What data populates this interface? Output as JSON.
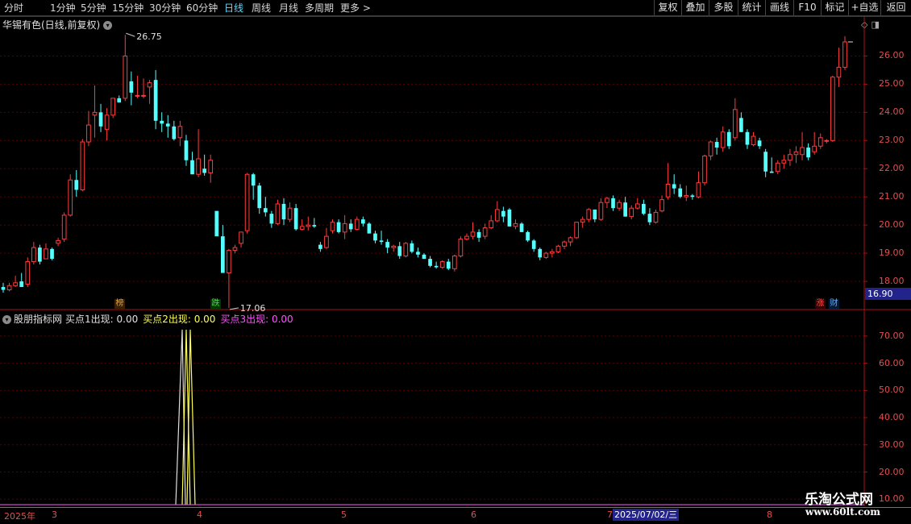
{
  "toolbar": {
    "periods": [
      "分时",
      "1分钟",
      "5分钟",
      "15分钟",
      "30分钟",
      "60分钟",
      "日线",
      "周线",
      "月线",
      "多周期",
      "更多 >"
    ],
    "active_period": "日线",
    "right_buttons": [
      "复权",
      "叠加",
      "多股",
      "统计",
      "画线",
      "F10",
      "标记",
      "+自选",
      "返回"
    ]
  },
  "main_chart": {
    "title": "华锡有色(日线,前复权)",
    "y_ticks": [
      "26.00",
      "25.00",
      "24.00",
      "23.00",
      "22.00",
      "21.00",
      "20.00",
      "19.00",
      "18.00"
    ],
    "high_label": "26.75",
    "low_label": "17.06",
    "current_price": "16.90",
    "markers": [
      {
        "text": "榜",
        "color": "#e0a030",
        "bg": "#3a2000"
      },
      {
        "text": "跌",
        "color": "#40e040",
        "bg": "#003a00"
      },
      {
        "text": "涨",
        "color": "#ff5050",
        "bg": "#3a0000"
      },
      {
        "text": "财",
        "color": "#5fa8ff",
        "bg": "#001a3a"
      }
    ]
  },
  "indicator": {
    "name": "股朋指标网",
    "buy1": "买点1出现: 0.00",
    "buy2": "买点2出现: 0.00",
    "buy3": "买点3出现: 0.00",
    "y_ticks": [
      "70.00",
      "60.00",
      "50.00",
      "40.00",
      "30.00",
      "20.00",
      "10.00"
    ]
  },
  "time_axis": {
    "labels": [
      "2025年",
      "3",
      "4",
      "5",
      "6",
      "7",
      "8"
    ],
    "current_date": "2025/07/02/三"
  },
  "watermark": {
    "name": "乐淘公式网",
    "url": "www.60lt.com"
  },
  "colors": {
    "up": "#ff3c3c",
    "down": "#54ffff",
    "axis": "#b01010",
    "grid": "#5a0000",
    "buy2_line": "#ffff54",
    "buy1_line": "#e0e0e0",
    "buy3_line": "#ff54ff"
  },
  "chart_data": {
    "type": "candlestick",
    "ylim": [
      17.4,
      26.9
    ],
    "ohlc": [
      [
        17.8,
        17.95,
        17.6,
        17.7
      ],
      [
        17.7,
        17.95,
        17.65,
        17.85
      ],
      [
        17.85,
        18.2,
        17.8,
        17.95
      ],
      [
        18.0,
        18.3,
        17.9,
        17.8
      ],
      [
        17.9,
        18.85,
        17.8,
        18.7
      ],
      [
        18.7,
        19.4,
        18.6,
        19.2
      ],
      [
        19.2,
        19.3,
        18.6,
        18.7
      ],
      [
        18.8,
        19.35,
        18.8,
        19.15
      ],
      [
        19.15,
        19.2,
        18.75,
        18.8
      ],
      [
        19.35,
        19.55,
        19.25,
        19.45
      ],
      [
        19.5,
        20.45,
        19.4,
        20.35
      ],
      [
        20.35,
        21.8,
        20.3,
        21.6
      ],
      [
        21.6,
        21.95,
        21.0,
        21.25
      ],
      [
        21.25,
        23.05,
        21.2,
        22.95
      ],
      [
        22.95,
        24.05,
        22.8,
        23.55
      ],
      [
        23.9,
        24.95,
        23.1,
        24.0
      ],
      [
        24.0,
        24.3,
        23.3,
        23.5
      ],
      [
        23.4,
        24.15,
        23.0,
        23.9
      ],
      [
        23.9,
        24.5,
        23.8,
        24.5
      ],
      [
        24.5,
        24.6,
        24.35,
        24.35
      ],
      [
        24.5,
        26.75,
        24.4,
        26.0
      ],
      [
        25.1,
        25.45,
        24.25,
        24.7
      ],
      [
        24.6,
        25.3,
        24.5,
        24.6
      ],
      [
        24.6,
        25.2,
        24.5,
        24.6
      ],
      [
        24.9,
        25.15,
        24.3,
        25.05
      ],
      [
        25.15,
        25.5,
        23.4,
        23.7
      ],
      [
        23.7,
        24.0,
        23.3,
        23.6
      ],
      [
        23.6,
        23.9,
        23.1,
        23.5
      ],
      [
        23.5,
        23.7,
        23.0,
        23.05
      ],
      [
        23.1,
        23.7,
        22.8,
        23.5
      ],
      [
        23.0,
        23.2,
        22.1,
        22.3
      ],
      [
        22.3,
        22.6,
        21.8,
        21.8
      ],
      [
        21.8,
        23.4,
        21.7,
        22.35
      ],
      [
        22.0,
        22.5,
        21.75,
        21.85
      ],
      [
        21.85,
        22.5,
        21.5,
        22.3
      ],
      [
        20.5,
        20.0,
        19.7,
        19.6
      ],
      [
        19.6,
        20.0,
        18.6,
        18.3
      ],
      [
        18.3,
        19.15,
        17.06,
        19.1
      ],
      [
        19.1,
        19.3,
        19.0,
        19.2
      ],
      [
        19.35,
        19.75,
        19.2,
        19.75
      ],
      [
        19.8,
        21.85,
        19.7,
        21.8
      ],
      [
        21.8,
        21.85,
        20.9,
        21.4
      ],
      [
        21.4,
        21.5,
        20.4,
        20.6
      ],
      [
        20.6,
        21.0,
        20.3,
        20.45
      ],
      [
        20.4,
        20.5,
        19.9,
        20.05
      ],
      [
        20.05,
        20.9,
        20.0,
        20.75
      ],
      [
        20.75,
        20.95,
        20.0,
        20.2
      ],
      [
        20.2,
        20.8,
        20.1,
        20.6
      ],
      [
        20.6,
        20.75,
        19.8,
        19.85
      ],
      [
        19.85,
        20.2,
        19.8,
        19.95
      ],
      [
        19.95,
        20.3,
        19.8,
        20.0
      ],
      [
        20.0,
        20.25,
        19.9,
        19.95
      ],
      [
        19.3,
        19.4,
        19.05,
        19.15
      ],
      [
        19.2,
        19.9,
        19.15,
        19.6
      ],
      [
        19.8,
        20.2,
        19.7,
        20.1
      ],
      [
        20.1,
        20.2,
        19.7,
        19.75
      ],
      [
        19.75,
        20.35,
        19.5,
        20.05
      ],
      [
        20.05,
        20.2,
        19.75,
        19.85
      ],
      [
        19.85,
        20.3,
        19.8,
        20.2
      ],
      [
        20.2,
        20.3,
        19.95,
        20.05
      ],
      [
        20.05,
        20.1,
        19.7,
        19.7
      ],
      [
        19.7,
        19.8,
        19.35,
        19.45
      ],
      [
        19.45,
        19.8,
        19.3,
        19.4
      ],
      [
        19.4,
        19.5,
        19.0,
        19.2
      ],
      [
        19.2,
        19.3,
        19.05,
        19.25
      ],
      [
        19.25,
        19.4,
        18.8,
        18.9
      ],
      [
        18.9,
        19.4,
        18.85,
        19.35
      ],
      [
        19.35,
        19.45,
        19.0,
        19.05
      ],
      [
        19.05,
        19.2,
        18.85,
        18.95
      ],
      [
        18.95,
        19.0,
        18.8,
        18.8
      ],
      [
        18.8,
        18.9,
        18.5,
        18.55
      ],
      [
        18.55,
        18.7,
        18.45,
        18.5
      ],
      [
        18.5,
        18.75,
        18.45,
        18.7
      ],
      [
        18.7,
        18.8,
        18.4,
        18.45
      ],
      [
        18.45,
        18.95,
        18.35,
        18.9
      ],
      [
        18.9,
        19.6,
        18.85,
        19.5
      ],
      [
        19.5,
        19.7,
        19.45,
        19.6
      ],
      [
        19.6,
        20.1,
        19.5,
        19.75
      ],
      [
        19.75,
        19.85,
        19.4,
        19.55
      ],
      [
        19.6,
        20.05,
        19.5,
        19.9
      ],
      [
        19.9,
        20.35,
        19.85,
        20.15
      ],
      [
        20.15,
        20.85,
        20.1,
        20.55
      ],
      [
        20.5,
        20.65,
        20.1,
        20.3
      ],
      [
        20.55,
        20.6,
        19.95,
        19.95
      ],
      [
        19.95,
        20.2,
        19.85,
        20.05
      ],
      [
        20.05,
        20.1,
        19.75,
        19.75
      ],
      [
        19.75,
        19.8,
        19.4,
        19.45
      ],
      [
        19.45,
        19.5,
        19.05,
        19.15
      ],
      [
        19.15,
        19.2,
        18.75,
        18.85
      ],
      [
        18.85,
        19.05,
        18.8,
        19.0
      ],
      [
        19.0,
        19.15,
        18.85,
        19.05
      ],
      [
        19.05,
        19.3,
        19.0,
        19.25
      ],
      [
        19.25,
        19.45,
        19.15,
        19.4
      ],
      [
        19.4,
        19.6,
        19.25,
        19.55
      ],
      [
        19.55,
        20.1,
        19.5,
        20.1
      ],
      [
        20.1,
        20.3,
        19.9,
        20.2
      ],
      [
        20.2,
        20.6,
        20.1,
        20.55
      ],
      [
        20.55,
        20.35,
        20.1,
        20.2
      ],
      [
        20.2,
        20.95,
        20.15,
        20.8
      ],
      [
        20.8,
        21.0,
        20.6,
        20.95
      ],
      [
        20.95,
        21.05,
        20.5,
        20.6
      ],
      [
        20.6,
        20.9,
        20.5,
        20.8
      ],
      [
        20.8,
        21.0,
        20.3,
        20.3
      ],
      [
        20.3,
        20.7,
        20.2,
        20.6
      ],
      [
        20.6,
        20.95,
        20.55,
        20.75
      ],
      [
        20.75,
        20.9,
        20.35,
        20.4
      ],
      [
        20.4,
        20.6,
        20.0,
        20.1
      ],
      [
        20.1,
        20.55,
        20.05,
        20.45
      ],
      [
        20.5,
        21.05,
        20.45,
        20.9
      ],
      [
        21.0,
        22.2,
        20.9,
        21.45
      ],
      [
        21.45,
        21.8,
        21.1,
        21.3
      ],
      [
        21.3,
        21.45,
        20.95,
        21.0
      ],
      [
        21.0,
        21.4,
        20.85,
        21.05
      ],
      [
        21.05,
        21.1,
        20.9,
        21.0
      ],
      [
        21.0,
        21.9,
        20.95,
        21.5
      ],
      [
        21.5,
        22.5,
        21.4,
        22.45
      ],
      [
        22.45,
        23.0,
        22.3,
        22.95
      ],
      [
        22.95,
        23.1,
        22.5,
        22.75
      ],
      [
        22.75,
        23.5,
        22.6,
        23.3
      ],
      [
        23.3,
        23.4,
        22.7,
        22.8
      ],
      [
        23.1,
        24.5,
        23.0,
        24.1
      ],
      [
        23.8,
        24.0,
        23.3,
        23.3
      ],
      [
        23.3,
        23.4,
        22.7,
        22.85
      ],
      [
        22.85,
        23.3,
        22.8,
        23.15
      ],
      [
        23.0,
        23.1,
        22.7,
        22.8
      ],
      [
        22.6,
        22.7,
        21.7,
        21.9
      ],
      [
        21.9,
        22.4,
        21.85,
        21.85
      ],
      [
        21.9,
        22.3,
        21.8,
        22.2
      ],
      [
        22.2,
        22.5,
        22.0,
        22.3
      ],
      [
        22.3,
        22.7,
        22.1,
        22.5
      ],
      [
        22.5,
        22.8,
        22.2,
        22.6
      ],
      [
        22.5,
        23.3,
        22.3,
        22.75
      ],
      [
        22.75,
        22.9,
        22.3,
        22.4
      ],
      [
        22.6,
        23.3,
        22.5,
        22.8
      ],
      [
        22.8,
        23.25,
        22.7,
        23.1
      ],
      [
        23.0,
        23.05,
        22.9,
        23.0
      ],
      [
        23.0,
        25.3,
        22.95,
        25.25
      ],
      [
        25.25,
        26.3,
        24.9,
        25.6
      ],
      [
        25.6,
        26.7,
        25.5,
        26.5
      ]
    ],
    "indicator_spike": {
      "value": 70.0,
      "ylim": [
        8.0,
        75.0
      ]
    }
  }
}
